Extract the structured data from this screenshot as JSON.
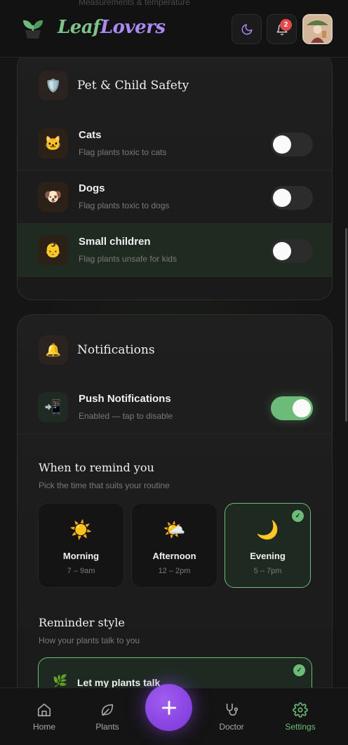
{
  "app": {
    "name_part1": "Leaf",
    "name_part2": "Lovers",
    "ghost_text": "Measurements & temperature",
    "notification_count": "2"
  },
  "safety": {
    "title": "Pet & Child Safety",
    "icon": "shield-icon",
    "rows": [
      {
        "title": "Cats",
        "subtitle": "Flag plants toxic to cats",
        "icon": "cat-icon",
        "enabled": false
      },
      {
        "title": "Dogs",
        "subtitle": "Flag plants toxic to dogs",
        "icon": "dog-icon",
        "enabled": false
      },
      {
        "title": "Small children",
        "subtitle": "Flag plants unsafe for kids",
        "icon": "child-icon",
        "enabled": false
      }
    ]
  },
  "notifications": {
    "title": "Notifications",
    "icon": "bell-icon",
    "push": {
      "title": "Push Notifications",
      "subtitle": "Enabled — tap to disable",
      "enabled": true,
      "icon": "phone-icon"
    },
    "remind": {
      "title": "When to remind you",
      "subtitle": "Pick the time that suits your routine",
      "options": [
        {
          "label": "Morning",
          "range": "7 – 9am",
          "icon": "sun-icon",
          "selected": false
        },
        {
          "label": "Afternoon",
          "range": "12 – 2pm",
          "icon": "sun-cloud-icon",
          "selected": false
        },
        {
          "label": "Evening",
          "range": "5 – 7pm",
          "icon": "moon-icon",
          "selected": true
        }
      ]
    },
    "style": {
      "title": "Reminder style",
      "subtitle": "How your plants talk to you",
      "selected_option": "Let my plants talk"
    }
  },
  "nav": {
    "home": "Home",
    "plants": "Plants",
    "doctor": "Doctor",
    "settings": "Settings",
    "active": "settings"
  },
  "colors": {
    "accent_green": "#6dbb78",
    "accent_purple": "#a98af5",
    "badge_red": "#e5484d"
  }
}
